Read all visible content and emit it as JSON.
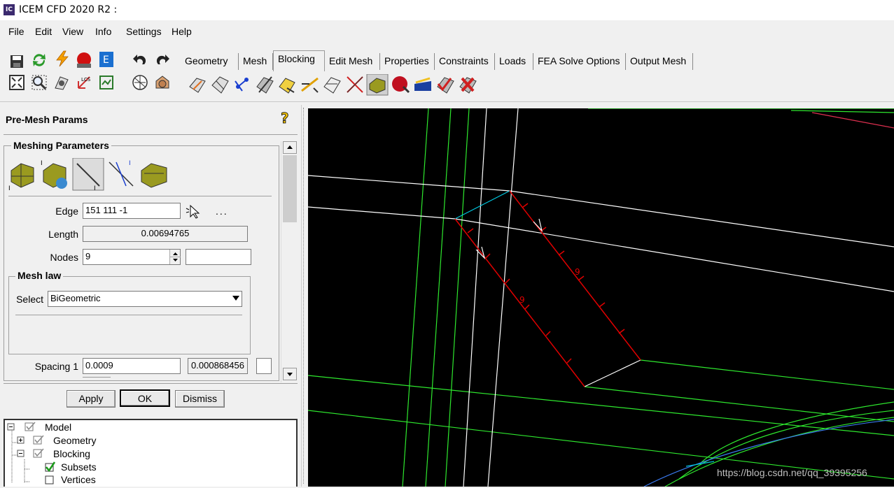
{
  "window": {
    "title": "ICEM CFD 2020 R2 :",
    "icon_text": "IC"
  },
  "menu": [
    "File",
    "Edit",
    "View",
    "Info",
    "Settings",
    "Help"
  ],
  "tabs": [
    "Geometry",
    "Mesh",
    "Blocking",
    "Edit Mesh",
    "Properties",
    "Constraints",
    "Loads",
    "FEA Solve Options",
    "Output Mesh"
  ],
  "active_tab": "Blocking",
  "panel": {
    "title": "Pre-Mesh Params",
    "group_title": "Meshing Parameters",
    "edge_label": "Edge",
    "edge_value": "151 111 -1",
    "edge_more": "...",
    "length_label": "Length",
    "length_value": "0.00694765",
    "nodes_label": "Nodes",
    "nodes_value": "9",
    "nodes_extra": "",
    "mesh_law_title": "Mesh law",
    "select_label": "Select",
    "select_value": "BiGeometric",
    "spacing1_label": "Spacing 1",
    "spacing1_value": "0.0009",
    "spacing1_actual": "0.000868456",
    "apply": "Apply",
    "ok": "OK",
    "dismiss": "Dismiss"
  },
  "tree": [
    {
      "label": "Model",
      "checked": true
    },
    {
      "label": "Geometry",
      "checked": true
    },
    {
      "label": "Blocking",
      "checked": true
    },
    {
      "label": "Subsets",
      "checked": true
    },
    {
      "label": "Vertices",
      "checked": false
    }
  ],
  "viewport": {
    "edge_node_labels": [
      "9",
      "9"
    ],
    "colors": {
      "background": "#000000",
      "geometry": "#2ee82e",
      "blocking": "#ffffff",
      "selected_edge": "#e00000",
      "curve_accent": "#00c8e0"
    }
  },
  "watermark": "https://blog.csdn.net/qq_39395256"
}
